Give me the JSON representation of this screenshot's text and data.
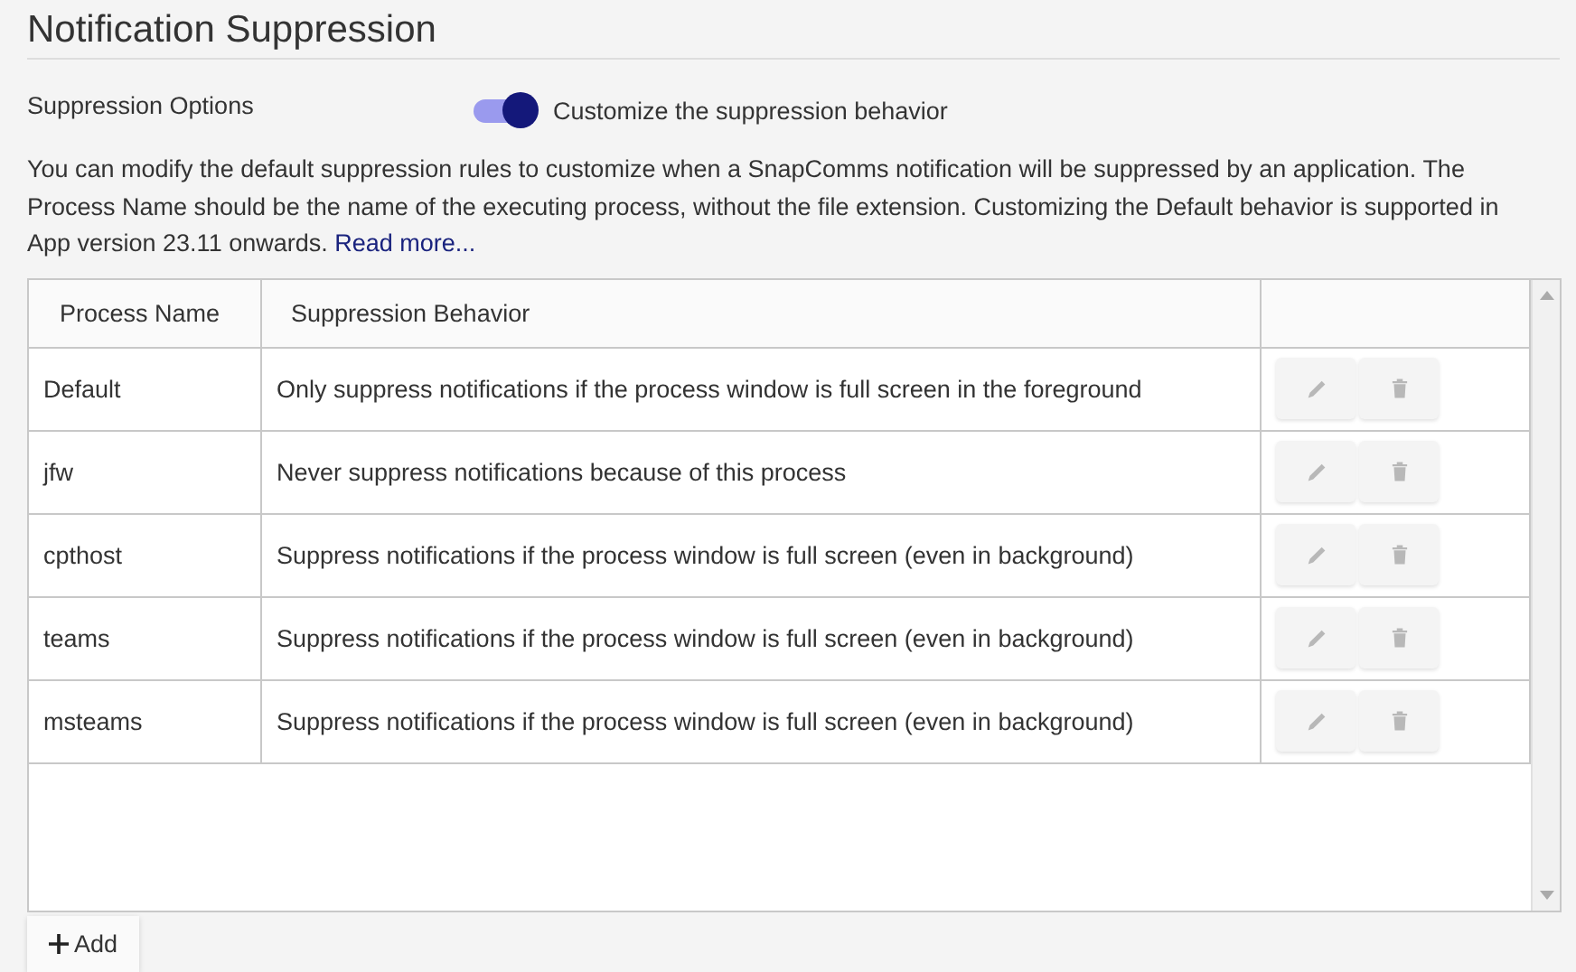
{
  "title": "Notification Suppression",
  "options": {
    "label": "Suppression Options",
    "toggle": {
      "on": true,
      "label": "Customize the suppression behavior"
    }
  },
  "description": "You can modify the default suppression rules to customize when a SnapComms notification will be suppressed by an application. The Process Name should be the name of the executing process, without the file extension. Customizing the Default behavior is supported in App version 23.11 onwards.",
  "read_more": "Read more...",
  "table": {
    "columns": [
      "Process Name",
      "Suppression Behavior"
    ],
    "rows": [
      {
        "process": "Default",
        "behavior": "Only suppress notifications if the process window is full screen in the foreground"
      },
      {
        "process": "jfw",
        "behavior": "Never suppress notifications because of this process"
      },
      {
        "process": "cpthost",
        "behavior": "Suppress notifications if the process window is full screen (even in background)"
      },
      {
        "process": "teams",
        "behavior": "Suppress notifications if the process window is full screen (even in background)"
      },
      {
        "process": "msteams",
        "behavior": "Suppress notifications if the process window is full screen (even in background)"
      }
    ]
  },
  "add_button": "Add"
}
